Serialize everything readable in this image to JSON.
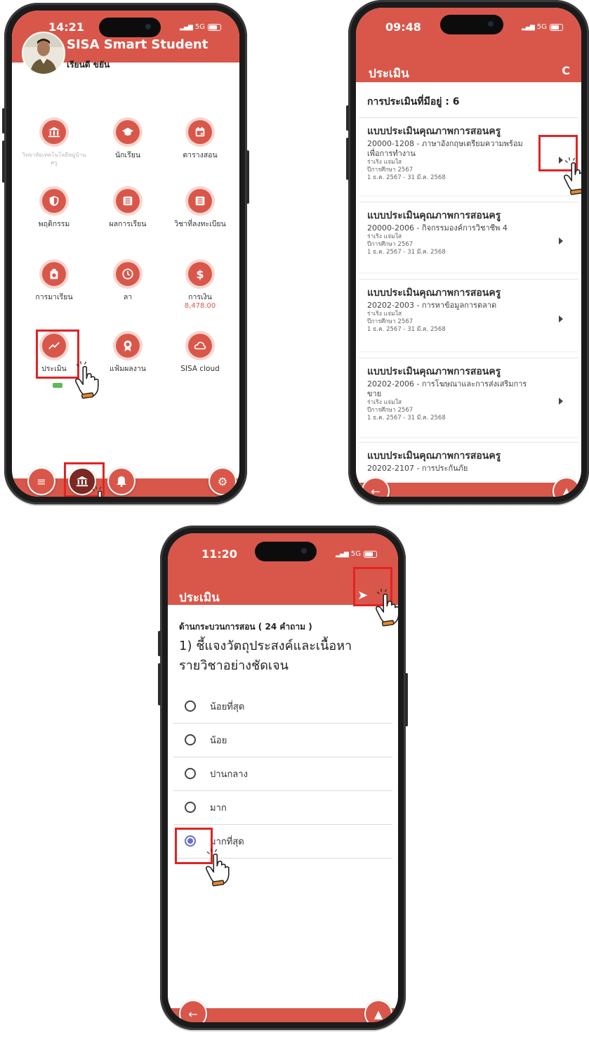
{
  "colors": {
    "accent": "#d9574a",
    "highlight": "#e02424",
    "radio_selected": "#6a6ec9"
  },
  "phone1": {
    "time": "14:21",
    "network": "5G",
    "app_title": "SISA Smart Student",
    "student_name": "เรียนดี ขยัน",
    "menu": [
      {
        "label": "วิทยาลัยเทคโนโลยีหมู่บ้านครู",
        "icon": "bank-icon"
      },
      {
        "label": "นักเรียน",
        "icon": "graduation-cap-icon"
      },
      {
        "label": "ตารางสอน",
        "icon": "calendar-icon"
      },
      {
        "label": "พฤติกรรม",
        "icon": "shield-icon"
      },
      {
        "label": "ผลการเรียน",
        "icon": "list-icon"
      },
      {
        "label": "วิชาที่ลงทะเบียน",
        "icon": "list-icon"
      },
      {
        "label": "การมาเรียน",
        "icon": "attendance-icon"
      },
      {
        "label": "ลา",
        "icon": "clock-icon"
      },
      {
        "label": "การเงิน",
        "icon": "dollar-icon",
        "sub": "8,478.00"
      },
      {
        "label": "ประเมิน",
        "icon": "trend-icon"
      },
      {
        "label": "แฟ้มผลงาน",
        "icon": "award-icon"
      },
      {
        "label": "SISA cloud",
        "icon": "cloud-icon"
      }
    ]
  },
  "phone2": {
    "time": "09:48",
    "network": "5G",
    "header": "ประเมิน",
    "count_label": "การประเมินที่มีอยู่ : 6",
    "cards": [
      {
        "title": "แบบประเมินคุณภาพการสอนครู",
        "course": "20000-1208 - ภาษาอังกฤษเตรียมความพร้อมเพื่อการทำงาน",
        "teacher": "ร่าเริง แจ่มใส",
        "year": "ปีการศึกษา 2567",
        "period": "1 ธ.ค. 2567 - 31 มี.ค. 2568"
      },
      {
        "title": "แบบประเมินคุณภาพการสอนครู",
        "course": "20000-2006 - กิจกรรมองค์การวิชาชีพ 4",
        "teacher": "ร่าเริง แจ่มใส",
        "year": "ปีการศึกษา 2567",
        "period": "1 ธ.ค. 2567 - 31 มี.ค. 2568"
      },
      {
        "title": "แบบประเมินคุณภาพการสอนครู",
        "course": "20202-2003 - การหาข้อมูลการตลาด",
        "teacher": "ร่าเริง แจ่มใส",
        "year": "ปีการศึกษา 2567",
        "period": "1 ธ.ค. 2567 - 31 มี.ค. 2568"
      },
      {
        "title": "แบบประเมินคุณภาพการสอนครู",
        "course": "20202-2006 - การโฆษณาและการส่งเสริมการขาย",
        "teacher": "ร่าเริง แจ่มใส",
        "year": "ปีการศึกษา 2567",
        "period": "1 ธ.ค. 2567 - 31 มี.ค. 2568"
      },
      {
        "title": "แบบประเมินคุณภาพการสอนครู",
        "course": "20202-2107 - การประกันภัย",
        "teacher": "",
        "year": "",
        "period": ""
      }
    ]
  },
  "phone3": {
    "time": "11:20",
    "network": "5G",
    "header": "ประเมิน",
    "section": "ด้านกระบวนการสอน ( 24 คำถาม )",
    "question": "1) ชี้แจงวัตถุประสงค์และเนื้อหารายวิชาอย่างชัดเจน",
    "options": [
      "น้อยที่สุด",
      "น้อย",
      "ปานกลาง",
      "มาก",
      "มากที่สุด"
    ],
    "selected_index": 4
  }
}
